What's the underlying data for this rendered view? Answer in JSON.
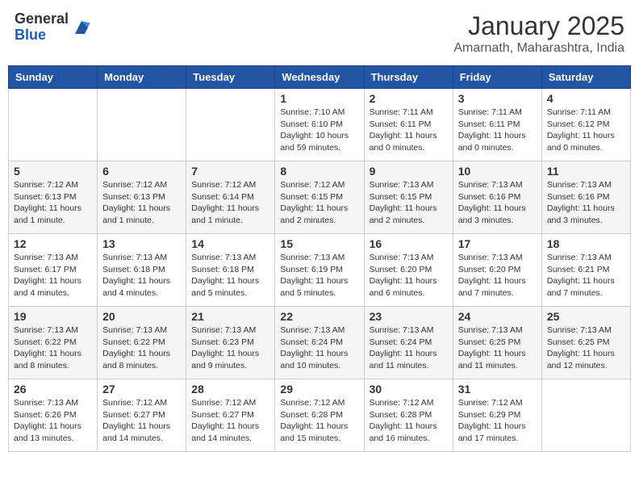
{
  "logo": {
    "general": "General",
    "blue": "Blue"
  },
  "header": {
    "month": "January 2025",
    "location": "Amarnath, Maharashtra, India"
  },
  "days_of_week": [
    "Sunday",
    "Monday",
    "Tuesday",
    "Wednesday",
    "Thursday",
    "Friday",
    "Saturday"
  ],
  "weeks": [
    [
      {
        "day": "",
        "info": ""
      },
      {
        "day": "",
        "info": ""
      },
      {
        "day": "",
        "info": ""
      },
      {
        "day": "1",
        "sunrise": "7:10 AM",
        "sunset": "6:10 PM",
        "daylight": "10 hours and 59 minutes."
      },
      {
        "day": "2",
        "sunrise": "7:11 AM",
        "sunset": "6:11 PM",
        "daylight": "11 hours and 0 minutes."
      },
      {
        "day": "3",
        "sunrise": "7:11 AM",
        "sunset": "6:11 PM",
        "daylight": "11 hours and 0 minutes."
      },
      {
        "day": "4",
        "sunrise": "7:11 AM",
        "sunset": "6:12 PM",
        "daylight": "11 hours and 0 minutes."
      }
    ],
    [
      {
        "day": "5",
        "sunrise": "7:12 AM",
        "sunset": "6:13 PM",
        "daylight": "11 hours and 1 minute."
      },
      {
        "day": "6",
        "sunrise": "7:12 AM",
        "sunset": "6:13 PM",
        "daylight": "11 hours and 1 minute."
      },
      {
        "day": "7",
        "sunrise": "7:12 AM",
        "sunset": "6:14 PM",
        "daylight": "11 hours and 1 minute."
      },
      {
        "day": "8",
        "sunrise": "7:12 AM",
        "sunset": "6:15 PM",
        "daylight": "11 hours and 2 minutes."
      },
      {
        "day": "9",
        "sunrise": "7:13 AM",
        "sunset": "6:15 PM",
        "daylight": "11 hours and 2 minutes."
      },
      {
        "day": "10",
        "sunrise": "7:13 AM",
        "sunset": "6:16 PM",
        "daylight": "11 hours and 3 minutes."
      },
      {
        "day": "11",
        "sunrise": "7:13 AM",
        "sunset": "6:16 PM",
        "daylight": "11 hours and 3 minutes."
      }
    ],
    [
      {
        "day": "12",
        "sunrise": "7:13 AM",
        "sunset": "6:17 PM",
        "daylight": "11 hours and 4 minutes."
      },
      {
        "day": "13",
        "sunrise": "7:13 AM",
        "sunset": "6:18 PM",
        "daylight": "11 hours and 4 minutes."
      },
      {
        "day": "14",
        "sunrise": "7:13 AM",
        "sunset": "6:18 PM",
        "daylight": "11 hours and 5 minutes."
      },
      {
        "day": "15",
        "sunrise": "7:13 AM",
        "sunset": "6:19 PM",
        "daylight": "11 hours and 5 minutes."
      },
      {
        "day": "16",
        "sunrise": "7:13 AM",
        "sunset": "6:20 PM",
        "daylight": "11 hours and 6 minutes."
      },
      {
        "day": "17",
        "sunrise": "7:13 AM",
        "sunset": "6:20 PM",
        "daylight": "11 hours and 7 minutes."
      },
      {
        "day": "18",
        "sunrise": "7:13 AM",
        "sunset": "6:21 PM",
        "daylight": "11 hours and 7 minutes."
      }
    ],
    [
      {
        "day": "19",
        "sunrise": "7:13 AM",
        "sunset": "6:22 PM",
        "daylight": "11 hours and 8 minutes."
      },
      {
        "day": "20",
        "sunrise": "7:13 AM",
        "sunset": "6:22 PM",
        "daylight": "11 hours and 8 minutes."
      },
      {
        "day": "21",
        "sunrise": "7:13 AM",
        "sunset": "6:23 PM",
        "daylight": "11 hours and 9 minutes."
      },
      {
        "day": "22",
        "sunrise": "7:13 AM",
        "sunset": "6:24 PM",
        "daylight": "11 hours and 10 minutes."
      },
      {
        "day": "23",
        "sunrise": "7:13 AM",
        "sunset": "6:24 PM",
        "daylight": "11 hours and 11 minutes."
      },
      {
        "day": "24",
        "sunrise": "7:13 AM",
        "sunset": "6:25 PM",
        "daylight": "11 hours and 11 minutes."
      },
      {
        "day": "25",
        "sunrise": "7:13 AM",
        "sunset": "6:25 PM",
        "daylight": "11 hours and 12 minutes."
      }
    ],
    [
      {
        "day": "26",
        "sunrise": "7:13 AM",
        "sunset": "6:26 PM",
        "daylight": "11 hours and 13 minutes."
      },
      {
        "day": "27",
        "sunrise": "7:12 AM",
        "sunset": "6:27 PM",
        "daylight": "11 hours and 14 minutes."
      },
      {
        "day": "28",
        "sunrise": "7:12 AM",
        "sunset": "6:27 PM",
        "daylight": "11 hours and 14 minutes."
      },
      {
        "day": "29",
        "sunrise": "7:12 AM",
        "sunset": "6:28 PM",
        "daylight": "11 hours and 15 minutes."
      },
      {
        "day": "30",
        "sunrise": "7:12 AM",
        "sunset": "6:28 PM",
        "daylight": "11 hours and 16 minutes."
      },
      {
        "day": "31",
        "sunrise": "7:12 AM",
        "sunset": "6:29 PM",
        "daylight": "11 hours and 17 minutes."
      },
      {
        "day": "",
        "info": ""
      }
    ]
  ],
  "labels": {
    "sunrise": "Sunrise:",
    "sunset": "Sunset:",
    "daylight": "Daylight:"
  }
}
